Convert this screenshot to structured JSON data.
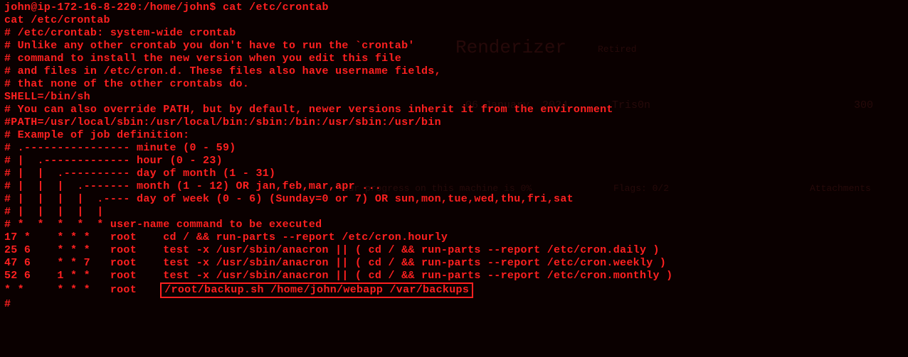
{
  "prompt": {
    "user_host": "john@ip-172-16-8-220",
    "path": ":/home/john$",
    "command": "cat /etc/crontab"
  },
  "output": {
    "echo": "cat /etc/crontab",
    "comment1": "# /etc/crontab: system-wide crontab",
    "comment2": "# Unlike any other crontab you don't have to run the `crontab'",
    "comment3": "# command to install the new version when you edit this file",
    "comment4": "# and files in /etc/cron.d. These files also have username fields,",
    "comment5": "# that none of the other crontabs do.",
    "blank1": "",
    "shell": "SHELL=/bin/sh",
    "pathcomment": "# You can also override PATH, but by default, newer versions inherit it from the environment",
    "pathline": "#PATH=/usr/local/sbin:/usr/local/bin:/sbin:/bin:/usr/sbin:/usr/bin",
    "blank2": "",
    "example": "# Example of job definition:",
    "def1": "# .---------------- minute (0 - 59)",
    "def2": "# |  .------------- hour (0 - 23)",
    "def3": "# |  |  .---------- day of month (1 - 31)",
    "def4": "# |  |  |  .------- month (1 - 12) OR jan,feb,mar,apr ...",
    "def5": "# |  |  |  |  .---- day of week (0 - 6) (Sunday=0 or 7) OR sun,mon,tue,wed,thu,fri,sat",
    "def6": "# |  |  |  |  |",
    "def7": "# *  *  *  *  * user-name command to be executed",
    "job1": "17 *    * * *   root    cd / && run-parts --report /etc/cron.hourly",
    "job2": "25 6    * * *   root    test -x /usr/sbin/anacron || ( cd / && run-parts --report /etc/cron.daily )",
    "job3": "47 6    * * 7   root    test -x /usr/sbin/anacron || ( cd / && run-parts --report /etc/cron.weekly )",
    "job4": "52 6    1 * *   root    test -x /usr/sbin/anacron || ( cd / && run-parts --report /etc/cron.monthly )",
    "job5_prefix": "* *     * * *   root    ",
    "job5_highlight": "/root/backup.sh /home/john/webapp /var/backups",
    "trailing": "#"
  },
  "bg": {
    "title": "Renderizer",
    "date": "06 January, 2024",
    "author": "Tris0n",
    "progress": "Your progress on this machine is  0%",
    "flags": "Flags: 0/2",
    "attach": "Attachments",
    "num": "300",
    "status": "Retired",
    "difficulty": ""
  }
}
